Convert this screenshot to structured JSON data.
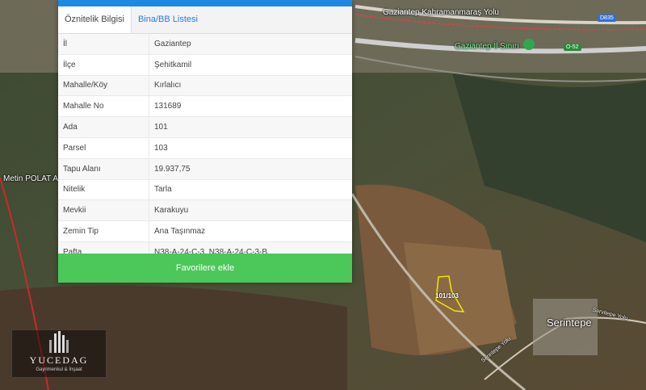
{
  "tabs": [
    {
      "label": "Öznitelik Bilgisi"
    },
    {
      "label": "Bina/BB Listesi"
    }
  ],
  "attributes": [
    {
      "key": "İl",
      "value": "Gaziantep"
    },
    {
      "key": "İlçe",
      "value": "Şehitkamil"
    },
    {
      "key": "Mahalle/Köy",
      "value": "Kırlalıcı"
    },
    {
      "key": "Mahalle No",
      "value": "131689"
    },
    {
      "key": "Ada",
      "value": "101"
    },
    {
      "key": "Parsel",
      "value": "103"
    },
    {
      "key": "Tapu Alanı",
      "value": "19.937,75"
    },
    {
      "key": "Nitelik",
      "value": "Tarla"
    },
    {
      "key": "Mevkii",
      "value": "Karakuyu"
    },
    {
      "key": "Zemin Tip",
      "value": "Ana Taşınmaz"
    },
    {
      "key": "Pafta",
      "value": "N38-A-24-C-3, N38-A-24-C-3-B"
    }
  ],
  "favorite_button": "Favorilere ekle",
  "map": {
    "road_label_1": "Gaziantep Kahramanmaraş Yolu",
    "road_label_2": "Gaziantep İl Sınırı",
    "road_badge_1": "D835",
    "road_badge_2": "O-52",
    "place_left": "Metin POLAT A",
    "place_serintepe": "Serintepe",
    "road_serintepe_1": "Servitepe Yolu",
    "road_serintepe_2": "Serintepe Yolu",
    "parcel_label": "101/103"
  },
  "watermark": "emlak",
  "logo": {
    "name": "YUCEDAG",
    "sub": "Gayrimenkul & İnşaat"
  },
  "colors": {
    "accent": "#1e88e5",
    "button": "#4cc75a",
    "parcel_outline": "#f2e600"
  }
}
